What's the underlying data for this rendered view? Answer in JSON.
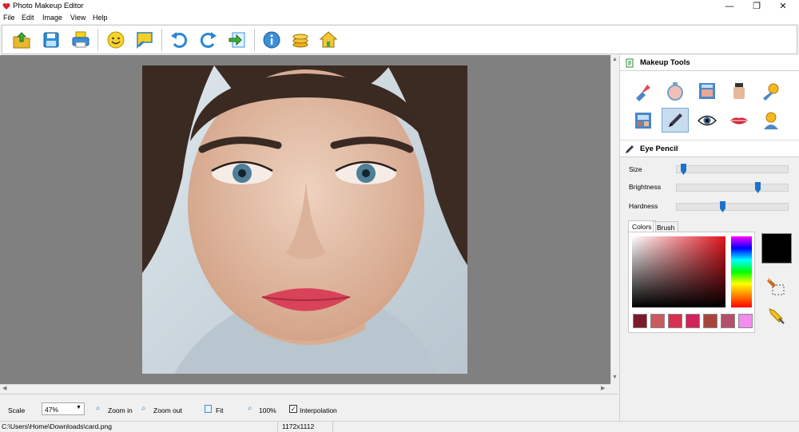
{
  "window": {
    "title": "Photo Makeup Editor",
    "minimize": "—",
    "maximize": "❐",
    "close": "✕"
  },
  "menu": [
    "File",
    "Edit",
    "Image",
    "View",
    "Help"
  ],
  "toolbar": {
    "buttons": [
      {
        "name": "open-icon"
      },
      {
        "name": "save-icon"
      },
      {
        "name": "print-icon"
      },
      {
        "name": "face-detect-icon"
      },
      {
        "name": "presentation-icon"
      },
      {
        "name": "undo-icon"
      },
      {
        "name": "redo-icon"
      },
      {
        "name": "export-icon"
      },
      {
        "name": "info-icon"
      },
      {
        "name": "coins-icon"
      },
      {
        "name": "home-icon"
      }
    ]
  },
  "panel": {
    "makeup_title": "Makeup Tools",
    "tools": [
      "lipstick-icon",
      "powder-icon",
      "blush-palette-icon",
      "foundation-icon",
      "settings-sparkle-icon",
      "eyeshadow-icon",
      "eye-pencil-icon",
      "eye-icon",
      "lips-icon",
      "hair-icon"
    ],
    "selected_tool": "Eye Pencil",
    "sliders": [
      {
        "label": "Size",
        "value": 0.04
      },
      {
        "label": "Brightness",
        "value": 0.74
      },
      {
        "label": "Hardness",
        "value": 0.41
      }
    ],
    "tabs": [
      "Colors",
      "Brush"
    ],
    "swatches": [
      "#7a1a2a",
      "#c85a60",
      "#d8304f",
      "#d0245a",
      "#a8453b",
      "#b4506c",
      "#f28cf0"
    ],
    "current_color": "#000000"
  },
  "bottom": {
    "scale_label": "Scale",
    "scale_value": "47%",
    "zoom_in": "Zoom in",
    "zoom_out": "Zoom out",
    "fit": "Fit",
    "actual": "100%",
    "interpolation": "Interpolation"
  },
  "status": {
    "path": "C:\\Users\\Home\\Downloads\\card.png",
    "dimensions": "1172x1112"
  }
}
